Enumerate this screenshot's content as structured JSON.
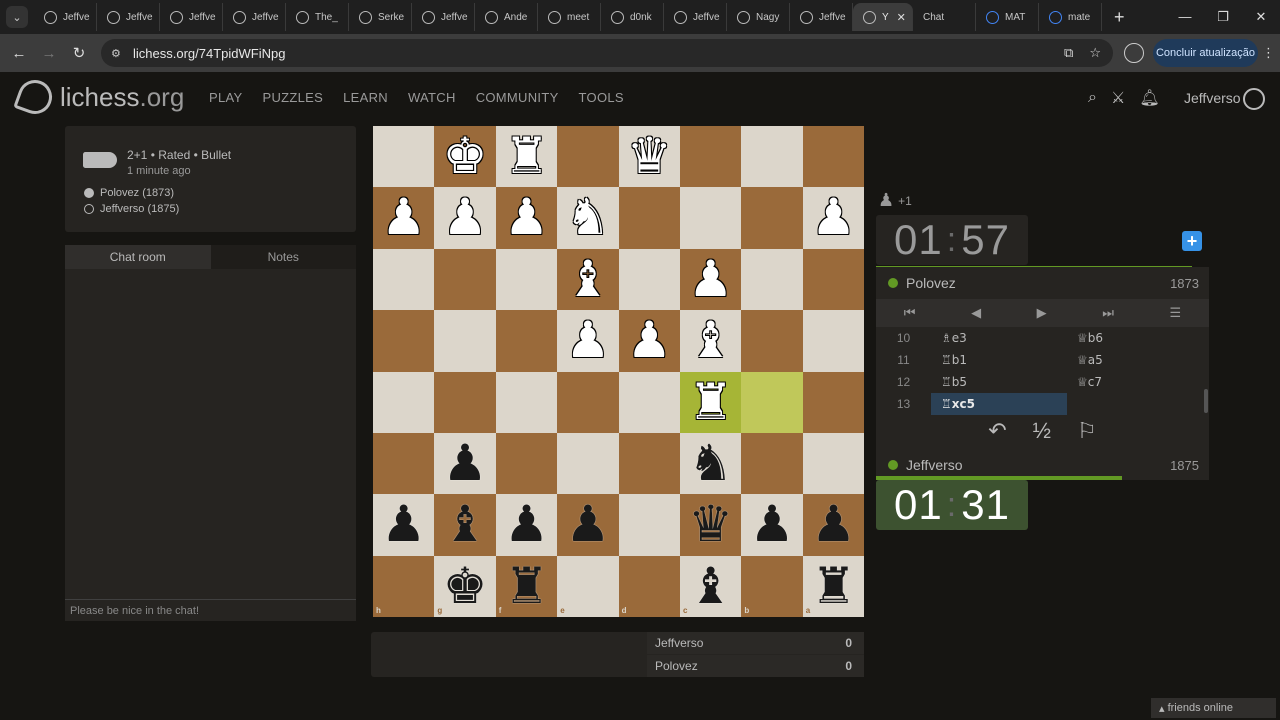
{
  "browser": {
    "tabs": [
      {
        "label": "Jeffve"
      },
      {
        "label": "Jeffve"
      },
      {
        "label": "Jeffve"
      },
      {
        "label": "Jeffve"
      },
      {
        "label": "The_"
      },
      {
        "label": "Serke"
      },
      {
        "label": "Jeffve"
      },
      {
        "label": "Ande"
      },
      {
        "label": "meet"
      },
      {
        "label": "d0nk"
      },
      {
        "label": "Jeffve"
      },
      {
        "label": "Nagy"
      },
      {
        "label": "Jeffve"
      }
    ],
    "active_tab": {
      "label": "Y"
    },
    "right_tabs": [
      {
        "label": "Chat"
      },
      {
        "label": "MAT"
      },
      {
        "label": "mate"
      }
    ],
    "url": "lichess.org/74TpidWFiNpg",
    "update_label": "Concluir atualização"
  },
  "header": {
    "logo_main": "lichess",
    "logo_org": ".org",
    "nav": [
      "PLAY",
      "PUZZLES",
      "LEARN",
      "WATCH",
      "COMMUNITY",
      "TOOLS"
    ],
    "username": "Jeffverso"
  },
  "game_info": {
    "title": "2+1 • Rated • Bullet",
    "time": "1 minute ago",
    "white": "Polovez (1873)",
    "black": "Jeffverso (1875)"
  },
  "chat": {
    "tab_chat": "Chat room",
    "tab_notes": "Notes",
    "placeholder": "Please be nice in the chat!"
  },
  "board": {
    "files": [
      "h",
      "g",
      "f",
      "e",
      "d",
      "c",
      "b",
      "a"
    ],
    "ranks": [
      "1",
      "2",
      "3",
      "4",
      "5",
      "6",
      "7",
      "8"
    ],
    "highlight": [
      "c5",
      "b5"
    ],
    "pieces": [
      {
        "sq": "g1",
        "p": "K",
        "c": "w"
      },
      {
        "sq": "f1",
        "p": "R",
        "c": "w"
      },
      {
        "sq": "d1",
        "p": "Q",
        "c": "w"
      },
      {
        "sq": "h2",
        "p": "P",
        "c": "w"
      },
      {
        "sq": "g2",
        "p": "P",
        "c": "w"
      },
      {
        "sq": "f2",
        "p": "P",
        "c": "w"
      },
      {
        "sq": "e2",
        "p": "N",
        "c": "w"
      },
      {
        "sq": "a2",
        "p": "P",
        "c": "w"
      },
      {
        "sq": "e3",
        "p": "B",
        "c": "w"
      },
      {
        "sq": "c3",
        "p": "P",
        "c": "w"
      },
      {
        "sq": "e4",
        "p": "P",
        "c": "w"
      },
      {
        "sq": "d4",
        "p": "P",
        "c": "w"
      },
      {
        "sq": "c4",
        "p": "B",
        "c": "w"
      },
      {
        "sq": "c5",
        "p": "R",
        "c": "w"
      },
      {
        "sq": "g6",
        "p": "P",
        "c": "b"
      },
      {
        "sq": "c6",
        "p": "N",
        "c": "b"
      },
      {
        "sq": "h7",
        "p": "P",
        "c": "b"
      },
      {
        "sq": "g7",
        "p": "B",
        "c": "b"
      },
      {
        "sq": "f7",
        "p": "P",
        "c": "b"
      },
      {
        "sq": "e7",
        "p": "P",
        "c": "b"
      },
      {
        "sq": "c7",
        "p": "Q",
        "c": "b"
      },
      {
        "sq": "b7",
        "p": "P",
        "c": "b"
      },
      {
        "sq": "a7",
        "p": "P",
        "c": "b"
      },
      {
        "sq": "g8",
        "p": "K",
        "c": "b"
      },
      {
        "sq": "f8",
        "p": "R",
        "c": "b"
      },
      {
        "sq": "c8",
        "p": "B",
        "c": "b"
      },
      {
        "sq": "a8",
        "p": "R",
        "c": "b"
      }
    ]
  },
  "material": "+1",
  "top_player": {
    "name": "Polovez",
    "rating": "1873",
    "clock_min": "01",
    "clock_sec": "57",
    "bar": 0.95
  },
  "bottom_player": {
    "name": "Jeffverso",
    "rating": "1875",
    "clock_min": "01",
    "clock_sec": "31",
    "bar": 0.74
  },
  "moves": [
    {
      "n": "10",
      "w": "♗e3",
      "b": "♕b6"
    },
    {
      "n": "11",
      "w": "♖b1",
      "b": "♕a5"
    },
    {
      "n": "12",
      "w": "♖b5",
      "b": "♕c7"
    },
    {
      "n": "13",
      "w": "♖xc5",
      "b": ""
    }
  ],
  "crosstable": [
    {
      "name": "Jeffverso",
      "score": "0"
    },
    {
      "name": "Polovez",
      "score": "0"
    }
  ],
  "friends_label": "friends online"
}
